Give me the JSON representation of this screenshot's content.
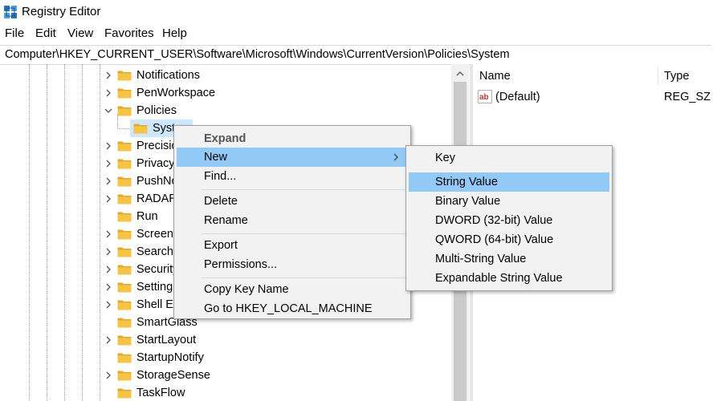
{
  "window": {
    "title": "Registry Editor"
  },
  "menubar": {
    "items": [
      "File",
      "Edit",
      "View",
      "Favorites",
      "Help"
    ]
  },
  "address": {
    "path": "Computer\\HKEY_CURRENT_USER\\Software\\Microsoft\\Windows\\CurrentVersion\\Policies\\System"
  },
  "tree": {
    "items": [
      {
        "label": "Notifications",
        "state": "collapsed"
      },
      {
        "label": "PenWorkspace",
        "state": "collapsed"
      },
      {
        "label": "Policies",
        "state": "expanded"
      },
      {
        "label": "System",
        "state": "selected-child"
      },
      {
        "label": "PrecisionTouchPad",
        "state": "collapsed"
      },
      {
        "label": "Privacy",
        "state": "collapsed"
      },
      {
        "label": "PushNotifications",
        "state": "collapsed"
      },
      {
        "label": "RADAR",
        "state": "collapsed"
      },
      {
        "label": "Run",
        "state": "leaf"
      },
      {
        "label": "Screensavers",
        "state": "collapsed"
      },
      {
        "label": "Search",
        "state": "collapsed"
      },
      {
        "label": "Security and Maintenance",
        "state": "collapsed"
      },
      {
        "label": "SettingSync",
        "state": "collapsed"
      },
      {
        "label": "Shell Extensions",
        "state": "collapsed"
      },
      {
        "label": "SmartGlass",
        "state": "leaf"
      },
      {
        "label": "StartLayout",
        "state": "collapsed"
      },
      {
        "label": "StartupNotify",
        "state": "leaf"
      },
      {
        "label": "StorageSense",
        "state": "collapsed"
      },
      {
        "label": "TaskFlow",
        "state": "leaf"
      }
    ]
  },
  "list": {
    "columns": [
      "Name",
      "Type"
    ],
    "rows": [
      {
        "name": "(Default)",
        "type": "REG_SZ"
      }
    ]
  },
  "context_menu": {
    "items": [
      {
        "label": "Expand",
        "bold": true
      },
      {
        "label": "New",
        "highlighted": true,
        "submenu": true
      },
      {
        "label": "Find..."
      },
      {
        "label": "Delete"
      },
      {
        "label": "Rename"
      },
      {
        "label": "Export"
      },
      {
        "label": "Permissions..."
      },
      {
        "label": "Copy Key Name"
      },
      {
        "label": "Go to HKEY_LOCAL_MACHINE"
      }
    ]
  },
  "new_submenu": {
    "items": [
      {
        "label": "Key"
      },
      {
        "label": "String Value",
        "highlighted": true
      },
      {
        "label": "Binary Value"
      },
      {
        "label": "DWORD (32-bit) Value"
      },
      {
        "label": "QWORD (64-bit) Value"
      },
      {
        "label": "Multi-String Value"
      },
      {
        "label": "Expandable String Value"
      }
    ]
  },
  "colors": {
    "highlight": "#91c9f7",
    "tree_selection": "#cce8ff",
    "folder": "#f6c342",
    "menu_bg": "#f2f2f2"
  }
}
